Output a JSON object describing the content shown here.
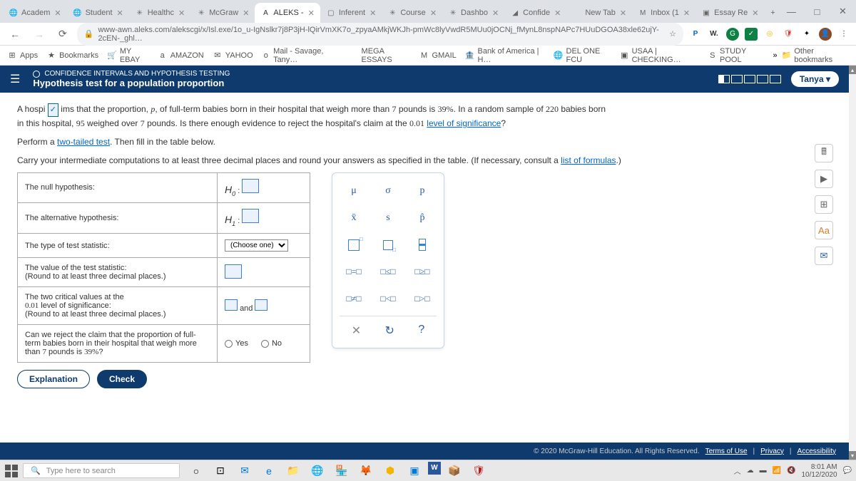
{
  "tabs": [
    {
      "icon": "🌐",
      "label": "Academ"
    },
    {
      "icon": "🌐",
      "label": "Student"
    },
    {
      "icon": "✳",
      "label": "Healthc"
    },
    {
      "icon": "✳",
      "label": "McGraw"
    },
    {
      "icon": "A",
      "label": "ALEKS -",
      "active": true
    },
    {
      "icon": "▢",
      "label": "Inferent"
    },
    {
      "icon": "✳",
      "label": "Course"
    },
    {
      "icon": "✳",
      "label": "Dashbo"
    },
    {
      "icon": "◢",
      "label": "Confide"
    },
    {
      "icon": "",
      "label": "New Tab"
    },
    {
      "icon": "M",
      "label": "Inbox (1"
    },
    {
      "icon": "▣",
      "label": "Essay Re"
    }
  ],
  "url": "www-awn.aleks.com/alekscgi/x/Isl.exe/1o_u-IgNslkr7j8P3jH-lQirVmXK7o_zpyaAMkjWKJh-pmWc8lyVwdR5MUu0jOCNj_fMynL8nspNAPc7HUuDGOA38xle62ujY-2cEN-_ghl…",
  "bookmarks": [
    {
      "icon": "⊞",
      "label": "Apps"
    },
    {
      "icon": "★",
      "label": "Bookmarks"
    },
    {
      "icon": "🛒",
      "label": "MY EBAY"
    },
    {
      "icon": "a",
      "label": "AMAZON"
    },
    {
      "icon": "✉",
      "label": "YAHOO"
    },
    {
      "icon": "o",
      "label": "Mail - Savage, Tany…"
    },
    {
      "icon": "",
      "label": "MEGA ESSAYS"
    },
    {
      "icon": "M",
      "label": "GMAIL"
    },
    {
      "icon": "🏦",
      "label": "Bank of America | H…"
    },
    {
      "icon": "🌐",
      "label": "DEL ONE FCU"
    },
    {
      "icon": "▣",
      "label": "USAA | CHECKING…"
    },
    {
      "icon": "S",
      "label": "STUDY POOL"
    }
  ],
  "other_bookmarks": "Other bookmarks",
  "header": {
    "breadcrumb": "CONFIDENCE INTERVALS AND HYPOTHESIS TESTING",
    "title": "Hypothesis test for a population proportion",
    "user": "Tanya"
  },
  "problem": {
    "line1a": "A hospi",
    "line1b": "ims that the proportion, ",
    "line1c": ", of full-term babies born in their hospital that weigh more than ",
    "seven": "7",
    "line1d": " pounds is ",
    "percent": "39%",
    "line1e": ". In a random sample of ",
    "sample": "220",
    "line1f": " babies born",
    "line2a": "in this hospital, ",
    "ninety5": "95",
    "line2b": " weighed over ",
    "line2c": " pounds. Is there enough evidence to reject the hospital's claim at the ",
    "alpha": "0.01",
    "los": "level of significance",
    "line3a": "Perform a ",
    "twotailed": "two-tailed test",
    "line3b": ". Then fill in the table below.",
    "line4a": "Carry your intermediate computations to at least three decimal places and round your answers as specified in the table. (If necessary, consult a ",
    "lof": "list of formulas",
    "line4b": ".)"
  },
  "table": {
    "row1": "The ",
    "null_hyp": "null hypothesis",
    "h0": "H",
    "sub0": "0",
    "row2": "The ",
    "alt_hyp": "alternative hypothesis",
    "sub1": "1",
    "row3a": "The type of ",
    "test_stat": "test statistic",
    "choose": "(Choose one)",
    "row4": "The value of the test statistic:",
    "row4b": "(Round to at least three decimal places.)",
    "row5a": "The two ",
    "crit_val": "critical values",
    "row5b": " at the",
    "row5c": " level of significance:",
    "row5d": "(Round to at least three decimal places.)",
    "and": "and",
    "row6": "Can we reject the claim that the proportion of full-term babies born in their hospital that weigh more than ",
    "row6b": " pounds is ",
    "yes": "Yes",
    "no": "No"
  },
  "palette": {
    "mu": "μ",
    "sigma": "σ",
    "p": "p",
    "xbar": "x̄",
    "s": "s",
    "phat": "p̂",
    "eq": "□=□",
    "le": "□≤□",
    "ge": "□≥□",
    "ne": "□≠□",
    "lt": "□<□",
    "gt": "□>□",
    "clear": "✕",
    "reset": "↻",
    "help": "?"
  },
  "buttons": {
    "explanation": "Explanation",
    "check": "Check"
  },
  "footer": {
    "copy": "© 2020 McGraw-Hill Education. All Rights Reserved.",
    "tou": "Terms of Use",
    "priv": "Privacy",
    "acc": "Accessibility"
  },
  "taskbar": {
    "search": "Type here to search",
    "time": "8:01 AM",
    "date": "10/12/2020"
  }
}
